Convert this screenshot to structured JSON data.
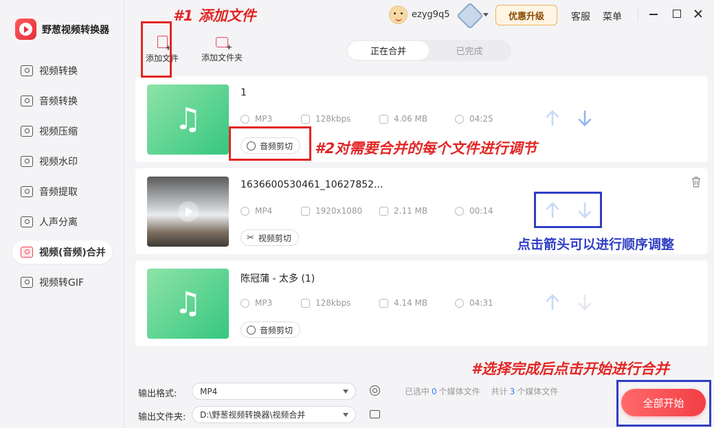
{
  "app": {
    "name": "野葱视频转换器"
  },
  "sidebar": {
    "items": [
      {
        "label": "视频转换",
        "icon": "video-convert-icon",
        "active": false
      },
      {
        "label": "音频转换",
        "icon": "audio-convert-icon",
        "active": false
      },
      {
        "label": "视频压缩",
        "icon": "video-compress-icon",
        "active": false
      },
      {
        "label": "视频水印",
        "icon": "video-watermark-icon",
        "active": false
      },
      {
        "label": "音频提取",
        "icon": "audio-extract-icon",
        "active": false
      },
      {
        "label": "人声分离",
        "icon": "voice-separate-icon",
        "active": false
      },
      {
        "label": "视频(音频)合并",
        "icon": "merge-icon",
        "active": true
      },
      {
        "label": "视频转GIF",
        "icon": "gif-icon",
        "active": false
      }
    ]
  },
  "toolbar": {
    "add_file": "添加文件",
    "add_folder": "添加文件夹"
  },
  "tabs": [
    {
      "label": "正在合并",
      "active": true
    },
    {
      "label": "已完成",
      "active": false
    }
  ],
  "header": {
    "username": "ezyg9q5",
    "upgrade": "优惠升级",
    "service": "客服",
    "menu": "菜单"
  },
  "files": [
    {
      "name": "1",
      "format": "MP3",
      "quality": "128kbps",
      "size": "4.06 MB",
      "duration": "04:25",
      "clip_label": "音频剪切",
      "kind": "audio"
    },
    {
      "name": "1636600530461_10627852...",
      "format": "MP4",
      "quality": "1920x1080",
      "size": "2.11 MB",
      "duration": "00:14",
      "clip_label": "视频剪切",
      "kind": "video"
    },
    {
      "name": "陈冠蒲 - 太多 (1)",
      "format": "MP3",
      "quality": "128kbps",
      "size": "4.14 MB",
      "duration": "04:31",
      "clip_label": "音频剪切",
      "kind": "audio"
    }
  ],
  "output": {
    "format_label": "输出格式:",
    "format_value": "MP4",
    "folder_label": "输出文件夹:",
    "folder_value": "D:\\野葱视频转换器\\视频合并"
  },
  "stats": {
    "selected_prefix": "已选中",
    "selected_count": "0",
    "selected_suffix": "个媒体文件",
    "total_prefix": "共计",
    "total_count": "3",
    "total_suffix": "个媒体文件"
  },
  "start_button": "全部开始",
  "annotations": {
    "step1": "#1 添加文件",
    "step2": "#2对需要合并的每个文件进行调节",
    "arrows": "点击箭头可以进行顺序调整",
    "step3": "#选择完成后点击开始进行合并"
  },
  "colors": {
    "accent": "#f0445a",
    "annotation_red": "#e32525",
    "annotation_blue": "#2f3ec4",
    "link_blue": "#3d7cf0"
  }
}
